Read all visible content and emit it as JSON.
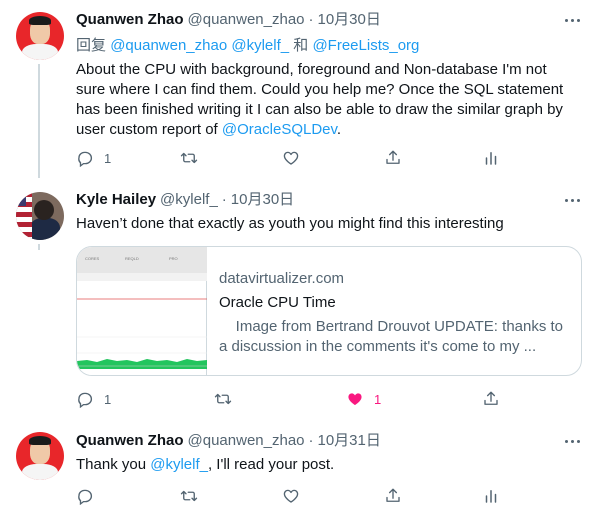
{
  "tweets": [
    {
      "author_name": "Quanwen Zhao",
      "author_handle": "@quanwen_zhao",
      "separator": "·",
      "time": "10月30日",
      "reply_prefix": "回复",
      "reply_handle1": "@quanwen_zhao",
      "reply_handle2": "@kylelf_",
      "reply_and": "和",
      "reply_handle3": "@FreeLists_org",
      "text_line1": "About the CPU with background, foreground and Non-database I'm not",
      "text_line2": "sure where I can find them. Could you help me? Once the SQL statement",
      "text_line3": "has been finished writing it I can also be able to draw the similar graph by",
      "text_line4_prefix": "user custom report of",
      "text_line4_link": "@OracleSQLDev",
      "text_line4_suffix": ".",
      "reply_count": "1",
      "retweet_count": "",
      "like_count": ""
    },
    {
      "author_name": "Kyle Hailey",
      "author_handle": "@kylelf_",
      "separator": "·",
      "time": "10月30日",
      "text": "Haven’t done that exactly as youth you might find this interesting",
      "reply_count": "1",
      "retweet_count": "",
      "like_count": "1",
      "card": {
        "domain": "datavirtualizer.com",
        "title": "Oracle CPU Time",
        "description_line1": "    Image from Bertrand Drouvot UPDATE: thanks to",
        "description_line2": "a discussion in the comments it's come to my ...",
        "thumb_headers": [
          "CORES",
          "REQLD",
          "PRO"
        ]
      }
    },
    {
      "author_name": "Quanwen Zhao",
      "author_handle": "@quanwen_zhao",
      "separator": "·",
      "time": "10月31日",
      "text_prefix": "Thank you",
      "text_link": "@kylelf_",
      "text_suffix": ", I'll read your post.",
      "reply_count": "",
      "retweet_count": "",
      "like_count": ""
    }
  ],
  "colors": {
    "text": "#0f1419",
    "secondary": "#536471",
    "link": "#1d9bf0",
    "like": "#f91880",
    "border": "#cfd9de"
  },
  "icons": [
    "reply-icon",
    "retweet-icon",
    "like-icon",
    "share-icon",
    "analytics-icon",
    "more-icon"
  ]
}
